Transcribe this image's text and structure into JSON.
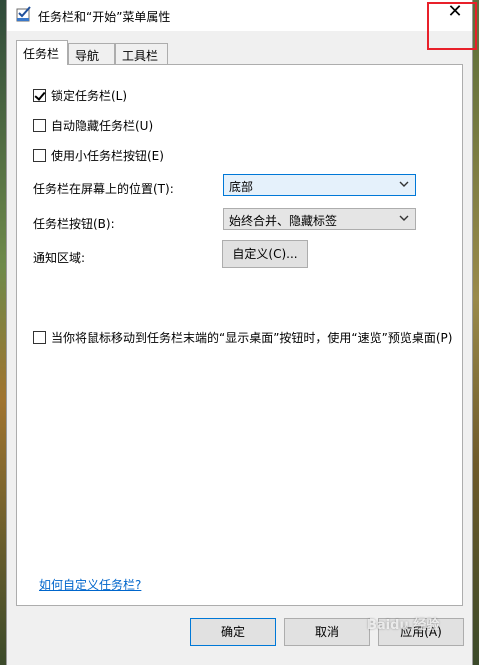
{
  "window": {
    "title": "任务栏和“开始”菜单属性",
    "close_glyph": "✕"
  },
  "tabs": [
    {
      "label": "任务栏",
      "active": true
    },
    {
      "label": "导航",
      "active": false
    },
    {
      "label": "工具栏",
      "active": false
    }
  ],
  "taskbar": {
    "lock": {
      "label": "锁定任务栏(L)",
      "checked": true
    },
    "autohide": {
      "label": "自动隐藏任务栏(U)",
      "checked": false
    },
    "small_buttons": {
      "label": "使用小任务栏按钮(E)",
      "checked": false
    },
    "position": {
      "label": "任务栏在屏幕上的位置(T):",
      "value": "底部"
    },
    "buttons": {
      "label": "任务栏按钮(B):",
      "value": "始终合并、隐藏标签"
    },
    "notification": {
      "label": "通知区域:",
      "customize_button": "自定义(C)..."
    },
    "peek": {
      "label": "当你将鼠标移动到任务栏末端的“显示桌面”按钮时，使用“速览”预览桌面(P)",
      "checked": false
    },
    "help_link": "如何自定义任务栏?"
  },
  "footer": {
    "ok": "确定",
    "cancel": "取消",
    "apply": "应用(A)"
  },
  "watermark": "Baidu 经验",
  "colors": {
    "highlight": "#e8202a",
    "accent": "#0078d7",
    "link": "#0066cc"
  }
}
